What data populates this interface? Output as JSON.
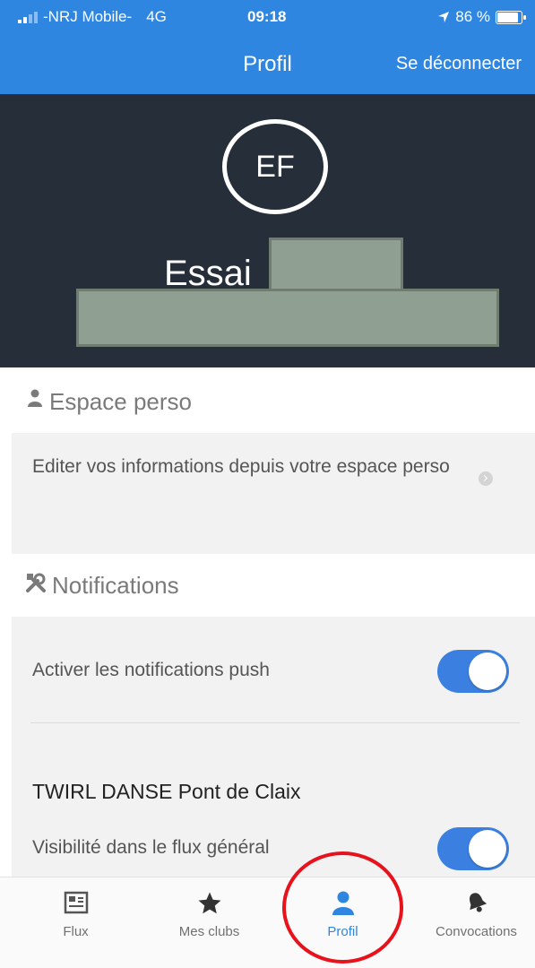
{
  "status_bar": {
    "carrier": "-NRJ Mobile-",
    "network": "4G",
    "time": "09:18",
    "battery": "86 %",
    "location_icon": "location-arrow-icon"
  },
  "nav": {
    "title": "Profil",
    "logout_label": "Se déconnecter"
  },
  "profile": {
    "initials": "EF",
    "first_name": "Essai"
  },
  "espace_perso": {
    "header_label": "Espace perso",
    "header_icon": "person-icon",
    "edit_text": "Editer vos informations depuis votre espace perso"
  },
  "notifications": {
    "header_label": "Notifications",
    "header_icon": "tools-icon",
    "push_label": "Activer les notifications push",
    "push_enabled": true,
    "club_name": "TWIRL DANSE Pont de Claix",
    "visibility_label": "Visibilité dans le flux général",
    "visibility_enabled": true
  },
  "tabs": [
    {
      "label": "Flux",
      "icon": "newspaper-icon",
      "active": false
    },
    {
      "label": "Mes clubs",
      "icon": "star-icon",
      "active": false
    },
    {
      "label": "Profil",
      "icon": "person-icon",
      "active": true
    },
    {
      "label": "Convocations",
      "icon": "bell-icon",
      "active": false
    }
  ],
  "colors": {
    "accent": "#2f86e0",
    "header_bg": "#262e3a",
    "toggle_on": "#3b80e0",
    "annotation": "#e8121d"
  }
}
